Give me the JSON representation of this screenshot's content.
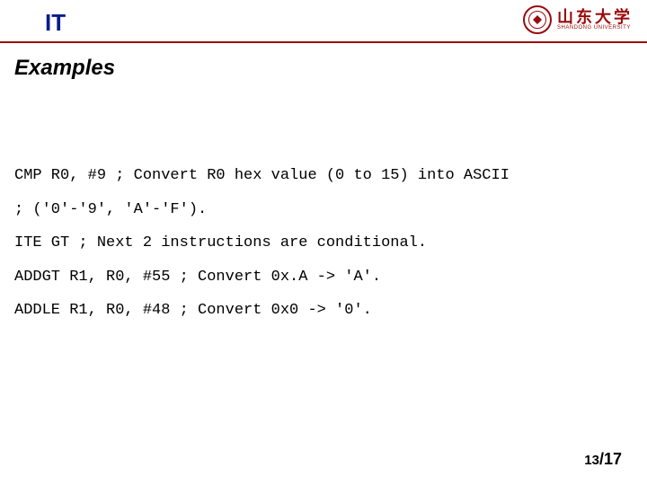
{
  "header": {
    "title": "IT",
    "university": {
      "name_cn": "山东大学",
      "name_en": "SHANDONG UNIVERSITY"
    }
  },
  "section": {
    "heading": "Examples"
  },
  "code": {
    "lines": [
      "CMP R0, #9 ; Convert R0 hex value (0 to 15) into ASCII",
      "; ('0'-'9', 'A'-'F').",
      "ITE GT ; Next 2 instructions are conditional.",
      "ADDGT R1, R0, #55 ; Convert 0x.A -> 'A'.",
      "ADDLE R1, R0, #48 ; Convert 0x0 -> '0'."
    ]
  },
  "footer": {
    "page_current": "13",
    "page_sep": "/",
    "page_total": "17"
  }
}
